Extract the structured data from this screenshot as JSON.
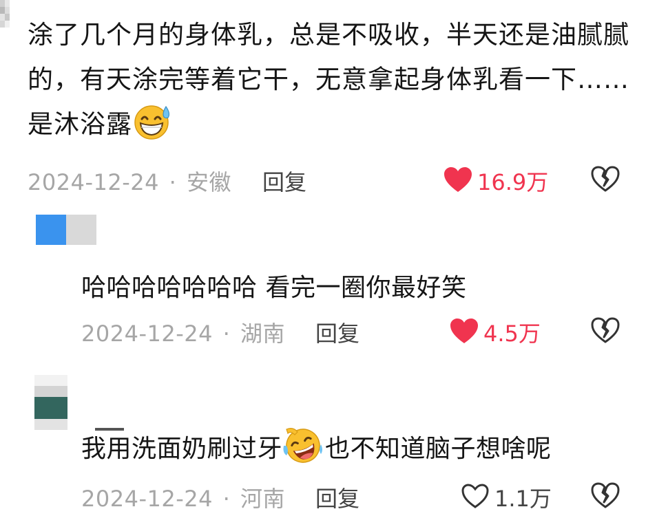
{
  "comments": [
    {
      "text_before_emoji": "涂了几个月的身体乳，总是不吸收，半天还是油腻腻的，有天涂完等着它干，无意拿起身体乳看一下……是沐浴露",
      "emoji": "grinning-sweat-emoji",
      "date": "2024-12-24",
      "separator": "·",
      "location": "安徽",
      "reply_label": "回复",
      "likes": "16.9万",
      "liked": true
    },
    {
      "text": "哈哈哈哈哈哈哈 看完一圈你最好笑",
      "date": "2024-12-24",
      "separator": "·",
      "location": "湖南",
      "reply_label": "回复",
      "likes": "4.5万",
      "liked": true
    },
    {
      "text_before_emoji": "我用洗面奶刷过牙",
      "emoji": "rolling-laughing-emoji",
      "text_after_emoji": "也不知道脑子想啥呢",
      "date": "2024-12-24",
      "separator": "·",
      "location": "河南",
      "reply_label": "回复",
      "likes": "1.1万",
      "liked": false
    }
  ],
  "colors": {
    "like_red": "#f0344f",
    "meta_gray": "#a6a6a6",
    "reply_dark": "#444444"
  },
  "icons": [
    "heart-filled-icon",
    "heart-outline-icon",
    "broken-heart-icon"
  ]
}
